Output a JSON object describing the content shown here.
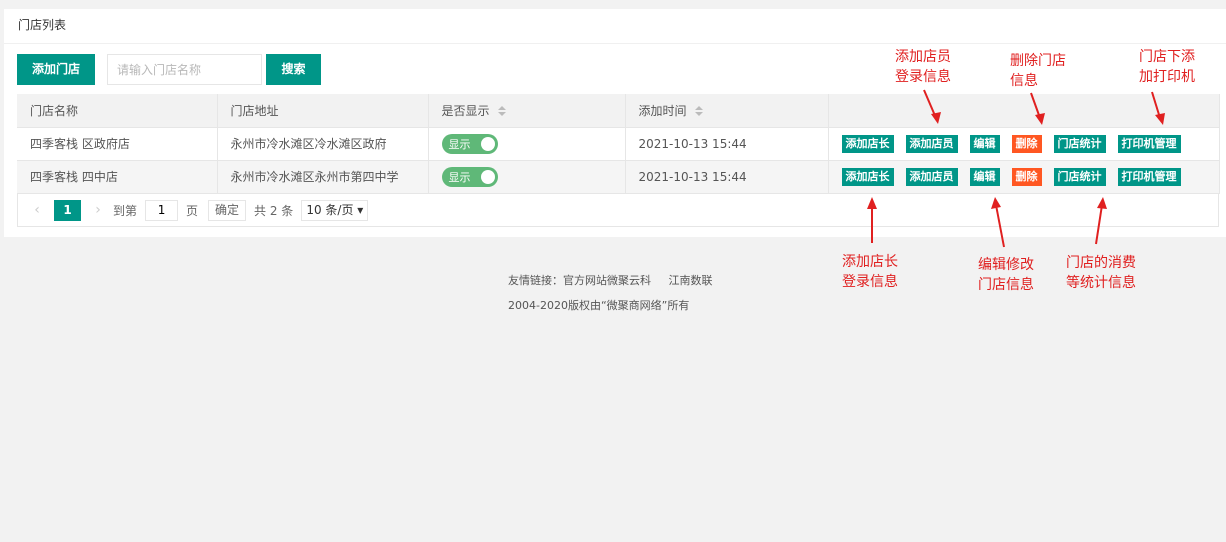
{
  "panel": {
    "title": "门店列表"
  },
  "toolbar": {
    "add_label": "添加门店",
    "search_placeholder": "请输入门店名称",
    "search_label": "搜索"
  },
  "table": {
    "columns": [
      "门店名称",
      "门店地址",
      "是否显示",
      "添加时间",
      ""
    ],
    "rows": [
      {
        "name": "四季客栈 区政府店",
        "address": "永州市冷水滩区冷水滩区政府",
        "visible": "显示",
        "time": "2021-10-13 15:44"
      },
      {
        "name": "四季客栈 四中店",
        "address": "永州市冷水滩区永州市第四中学",
        "visible": "显示",
        "time": "2021-10-13 15:44"
      }
    ],
    "ops": [
      "添加店长",
      "添加店员",
      "编辑",
      "删除",
      "门店统计",
      "打印机管理"
    ]
  },
  "pager": {
    "prev": "‹",
    "current": "1",
    "next": "›",
    "goto_label": "到第",
    "goto_value": "1",
    "page_unit": "页",
    "confirm": "确定",
    "total": "共 2 条",
    "page_size": "10 条/页"
  },
  "footer": {
    "links_label": "友情链接：",
    "link1": "官方网站微聚云科",
    "link2": "江南数联",
    "copyright": "2004-2020版权由“微聚商网络”所有"
  },
  "annotations": {
    "add_clerk": [
      "添加店员",
      "登录信息"
    ],
    "delete_store": [
      "删除门店",
      "信息"
    ],
    "printer": [
      "门店下添",
      "加打印机"
    ],
    "add_manager": [
      "添加店长",
      "登录信息"
    ],
    "edit": [
      "编辑修改",
      "门店信息"
    ],
    "stats": [
      "门店的消费",
      "等统计信息"
    ]
  },
  "colors": {
    "primary": "#009688",
    "danger": "#ff5722",
    "switch": "#5fb878",
    "annotation": "#e02020"
  }
}
